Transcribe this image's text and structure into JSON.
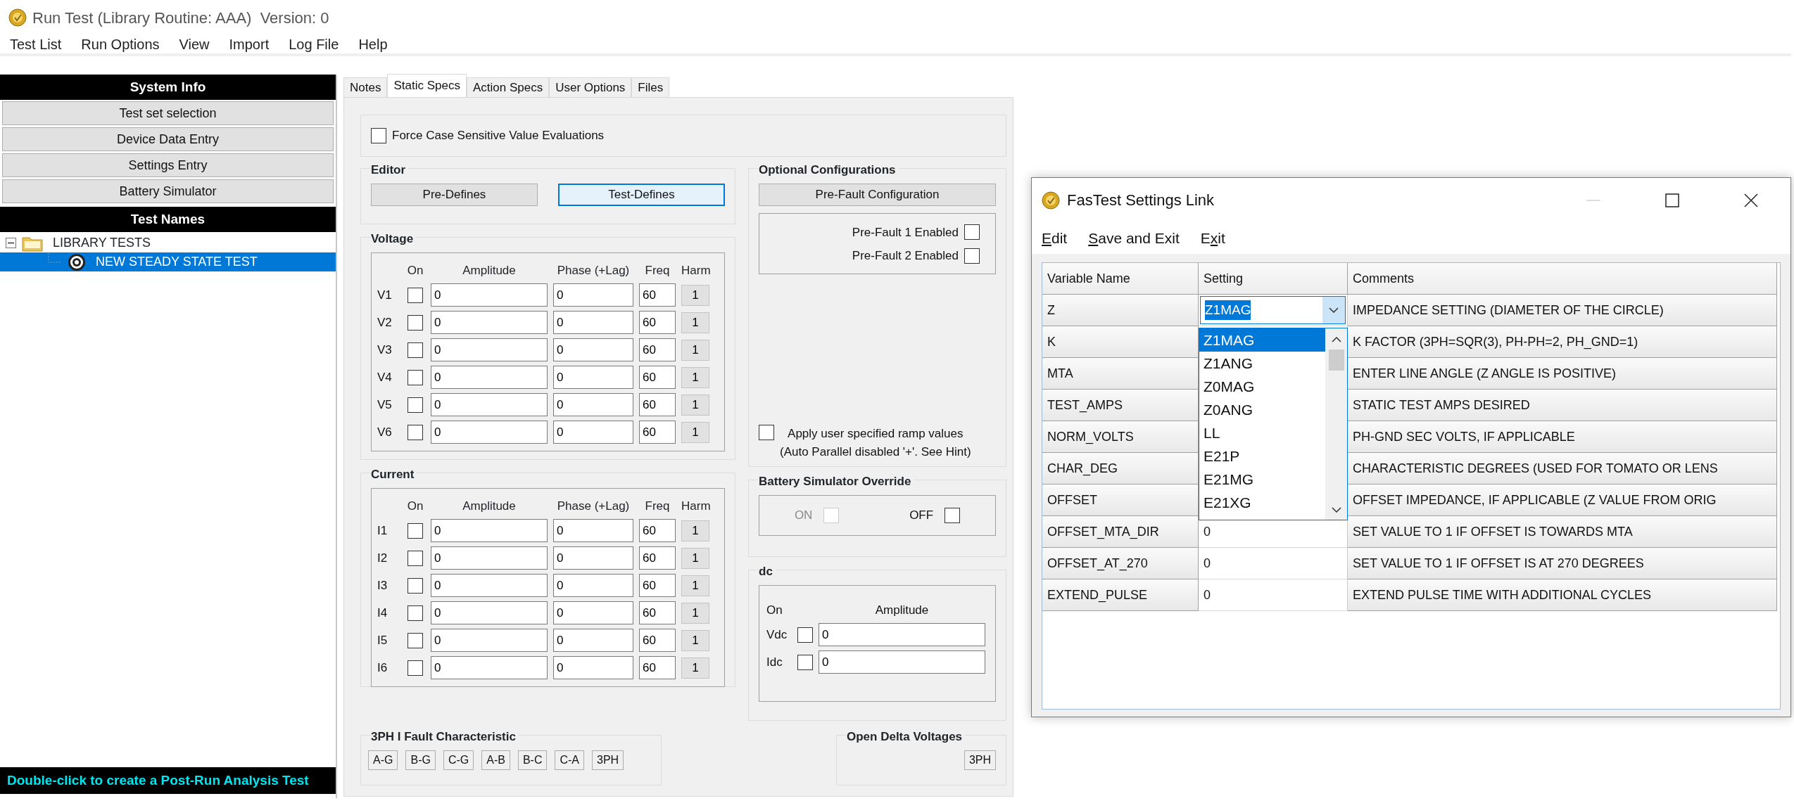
{
  "window": {
    "title": "Run Test (Library Routine: AAA)  Version: 0"
  },
  "menu": [
    "Test List",
    "Run Options",
    "View",
    "Import",
    "Log File",
    "Help"
  ],
  "system_info": {
    "header": "System Info",
    "buttons": [
      "Test set selection",
      "Device Data Entry",
      "Settings Entry",
      "Battery Simulator"
    ]
  },
  "test_names": {
    "header": "Test Names",
    "tree": [
      {
        "label": "LIBRARY TESTS",
        "expanded": true,
        "selected": false,
        "children": [
          {
            "label": "NEW STEADY STATE TEST",
            "selected": true
          }
        ]
      }
    ]
  },
  "footer_hint": "Double-click to create a Post-Run Analysis Test",
  "tabs": [
    {
      "label": "Notes",
      "selected": false
    },
    {
      "label": "Static Specs",
      "selected": true
    },
    {
      "label": "Action Specs",
      "selected": false
    },
    {
      "label": "User Options",
      "selected": false
    },
    {
      "label": "Files",
      "selected": false
    }
  ],
  "static_specs": {
    "force_case": {
      "label": "Force Case Sensitive Value Evaluations",
      "checked": false
    },
    "editor": {
      "title": "Editor",
      "buttons": [
        {
          "label": "Pre-Defines",
          "selected": false
        },
        {
          "label": "Test-Defines",
          "selected": true
        }
      ]
    },
    "voltage": {
      "title": "Voltage",
      "columns": [
        "On",
        "Amplitude",
        "Phase (+Lag)",
        "Freq",
        "Harm"
      ],
      "rows": [
        {
          "name": "V1",
          "on": false,
          "amplitude": "0",
          "phase": "0",
          "freq": "60",
          "harm": "1"
        },
        {
          "name": "V2",
          "on": false,
          "amplitude": "0",
          "phase": "0",
          "freq": "60",
          "harm": "1"
        },
        {
          "name": "V3",
          "on": false,
          "amplitude": "0",
          "phase": "0",
          "freq": "60",
          "harm": "1"
        },
        {
          "name": "V4",
          "on": false,
          "amplitude": "0",
          "phase": "0",
          "freq": "60",
          "harm": "1"
        },
        {
          "name": "V5",
          "on": false,
          "amplitude": "0",
          "phase": "0",
          "freq": "60",
          "harm": "1"
        },
        {
          "name": "V6",
          "on": false,
          "amplitude": "0",
          "phase": "0",
          "freq": "60",
          "harm": "1"
        }
      ]
    },
    "current": {
      "title": "Current",
      "columns": [
        "On",
        "Amplitude",
        "Phase (+Lag)",
        "Freq",
        "Harm"
      ],
      "rows": [
        {
          "name": "I1",
          "on": false,
          "amplitude": "0",
          "phase": "0",
          "freq": "60",
          "harm": "1"
        },
        {
          "name": "I2",
          "on": false,
          "amplitude": "0",
          "phase": "0",
          "freq": "60",
          "harm": "1"
        },
        {
          "name": "I3",
          "on": false,
          "amplitude": "0",
          "phase": "0",
          "freq": "60",
          "harm": "1"
        },
        {
          "name": "I4",
          "on": false,
          "amplitude": "0",
          "phase": "0",
          "freq": "60",
          "harm": "1"
        },
        {
          "name": "I5",
          "on": false,
          "amplitude": "0",
          "phase": "0",
          "freq": "60",
          "harm": "1"
        },
        {
          "name": "I6",
          "on": false,
          "amplitude": "0",
          "phase": "0",
          "freq": "60",
          "harm": "1"
        }
      ]
    },
    "fault_characteristic": {
      "title": "3PH I Fault Characteristic",
      "buttons": [
        "A-G",
        "B-G",
        "C-G",
        "A-B",
        "B-C",
        "C-A",
        "3PH"
      ]
    },
    "optional_configurations": {
      "title": "Optional Configurations",
      "button": "Pre-Fault Configuration",
      "options": [
        {
          "label": "Pre-Fault 1 Enabled",
          "checked": false
        },
        {
          "label": "Pre-Fault 2 Enabled",
          "checked": false
        }
      ],
      "ramp": {
        "label": "Apply user specified ramp values",
        "note": "(Auto Parallel disabled '+'. See Hint)",
        "checked": false
      }
    },
    "battery_override": {
      "title": "Battery Simulator Override",
      "options": [
        {
          "label": "ON",
          "checked": false,
          "disabled": true
        },
        {
          "label": "OFF",
          "checked": false,
          "disabled": false
        }
      ]
    },
    "dc": {
      "title": "dc",
      "columns": [
        "On",
        "Amplitude"
      ],
      "rows": [
        {
          "name": "Vdc",
          "on": false,
          "amplitude": "0"
        },
        {
          "name": "Idc",
          "on": false,
          "amplitude": "0"
        }
      ]
    },
    "open_delta": {
      "title": "Open Delta Voltages",
      "buttons": [
        "3PH"
      ]
    }
  },
  "settings_dialog": {
    "title": "FasTest Settings Link",
    "menu": [
      {
        "key": "E",
        "post": "dit"
      },
      {
        "key": "S",
        "post": "ave and Exit"
      },
      {
        "pre": "E",
        "key": "x",
        "post": "it"
      }
    ],
    "table": {
      "columns": [
        "Variable Name",
        "Setting",
        "Comments"
      ],
      "rows": [
        {
          "variable": "Z",
          "setting": "Z1MAG",
          "editing": true,
          "comment": "IMPEDANCE SETTING (DIAMETER OF THE CIRCLE)"
        },
        {
          "variable": "K",
          "editing": false,
          "comment": "K FACTOR (3PH=SQR(3), PH-PH=2, PH_GND=1)"
        },
        {
          "variable": "MTA",
          "editing": false,
          "comment": "ENTER LINE ANGLE (Z ANGLE IS POSITIVE)"
        },
        {
          "variable": "TEST_AMPS",
          "editing": false,
          "comment": "STATIC TEST AMPS DESIRED"
        },
        {
          "variable": "NORM_VOLTS",
          "editing": false,
          "comment": "PH-GND SEC VOLTS, IF APPLICABLE"
        },
        {
          "variable": "CHAR_DEG",
          "editing": false,
          "comment": "CHARACTERISTIC DEGREES (USED FOR TOMATO OR LENS"
        },
        {
          "variable": "OFFSET",
          "editing": false,
          "comment": "OFFSET IMPEDANCE, IF APPLICABLE (Z VALUE FROM ORIG"
        },
        {
          "variable": "OFFSET_MTA_DIR",
          "setting": "0",
          "editing": false,
          "comment": "SET VALUE TO 1 IF OFFSET IS TOWARDS MTA"
        },
        {
          "variable": "OFFSET_AT_270",
          "setting": "0",
          "editing": false,
          "comment": "SET VALUE TO 1 IF OFFSET IS AT 270 DEGREES"
        },
        {
          "variable": "EXTEND_PULSE",
          "setting": "0",
          "editing": false,
          "comment": "EXTEND PULSE TIME WITH ADDITIONAL CYCLES"
        }
      ]
    },
    "dropdown": {
      "options": [
        {
          "label": "Z1MAG",
          "selected": true
        },
        {
          "label": "Z1ANG",
          "selected": false
        },
        {
          "label": "Z0MAG",
          "selected": false
        },
        {
          "label": "Z0ANG",
          "selected": false
        },
        {
          "label": "LL",
          "selected": false
        },
        {
          "label": "E21P",
          "selected": false
        },
        {
          "label": "E21MG",
          "selected": false
        },
        {
          "label": "E21XG",
          "selected": false
        }
      ]
    }
  }
}
